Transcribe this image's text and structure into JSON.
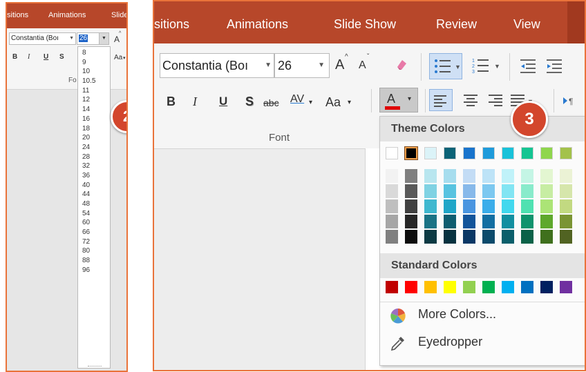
{
  "left_panel": {
    "tabs": [
      "sitions",
      "Animations",
      "Slide"
    ],
    "font_name": "Constantia (Boı",
    "font_size": "26",
    "grow_font": "A",
    "fmt": {
      "bold": "B",
      "italic": "I",
      "underline": "U",
      "shadow": "S",
      "change_case": "Aa"
    },
    "group_label": "Font",
    "group_label_visible": "Fo",
    "size_options": [
      "8",
      "9",
      "10",
      "10.5",
      "11",
      "12",
      "14",
      "16",
      "18",
      "20",
      "24",
      "28",
      "32",
      "36",
      "40",
      "44",
      "48",
      "54",
      "60",
      "66",
      "72",
      "80",
      "88",
      "96"
    ],
    "callout_number": "2"
  },
  "right_panel": {
    "tabs": [
      "sitions",
      "Animations",
      "Slide Show",
      "Review",
      "View"
    ],
    "font_name": "Constantia (Boı",
    "font_size": "26",
    "grow_font": "A",
    "shrink_font": "A",
    "fmt": {
      "bold": "B",
      "italic": "I",
      "underline": "U",
      "shadow": "S",
      "strike": "abc",
      "spacing": "AV",
      "change_case": "Aa",
      "font_color": "A"
    },
    "group_label": "Font",
    "callout_number": "3",
    "color_menu": {
      "theme_heading": "Theme Colors",
      "standard_heading": "Standard Colors",
      "more_colors": "More Colors...",
      "eyedropper": "Eyedropper",
      "theme_colors": [
        {
          "top": "#ffffff",
          "shades": [
            "#f2f2f2",
            "#d9d9d9",
            "#bfbfbf",
            "#a6a6a6",
            "#808080"
          ]
        },
        {
          "top": "#000000",
          "shades": [
            "#7f7f7f",
            "#595959",
            "#404040",
            "#262626",
            "#0d0d0d"
          ]
        },
        {
          "top": "#dbf3f8",
          "shades": [
            "#b8e6ef",
            "#7fd2e3",
            "#3fb8cf",
            "#1a7385",
            "#0c3a43"
          ]
        },
        {
          "top": "#0b6377",
          "shades": [
            "#a6ddee",
            "#58c3e0",
            "#20a6c8",
            "#0e5d70",
            "#073240"
          ]
        },
        {
          "top": "#1974cc",
          "shades": [
            "#c3dcf5",
            "#87b9ea",
            "#4a95e0",
            "#12549a",
            "#0a3866"
          ]
        },
        {
          "top": "#1f9bdb",
          "shades": [
            "#bde3f7",
            "#7cc8f0",
            "#3badea",
            "#126ea2",
            "#0b4a6b"
          ]
        },
        {
          "top": "#19c2d9",
          "shades": [
            "#c0f2f9",
            "#82e5f3",
            "#42d8ee",
            "#128fa0",
            "#0b5f6b"
          ]
        },
        {
          "top": "#15c592",
          "shades": [
            "#c4f5e5",
            "#89ebcb",
            "#4fe1b1",
            "#0f936d",
            "#0a6248"
          ]
        },
        {
          "top": "#8fd64d",
          "shades": [
            "#e3f6d1",
            "#c7eda3",
            "#abe476",
            "#5ea82c",
            "#3f701d"
          ]
        },
        {
          "top": "#a3c24b",
          "shades": [
            "#ebf2d5",
            "#d6e6ab",
            "#c2d981",
            "#7a9433",
            "#516322"
          ]
        }
      ],
      "standard_colors": [
        "#c00000",
        "#ff0000",
        "#ffc000",
        "#ffff00",
        "#92d050",
        "#00b050",
        "#00b0f0",
        "#0070c0",
        "#002060",
        "#7030a0"
      ]
    }
  },
  "colors": {
    "accent": "#e9733a",
    "tab_bar": "#b7472a",
    "callout": "#d3462c",
    "highlight": "#1e64c8"
  }
}
